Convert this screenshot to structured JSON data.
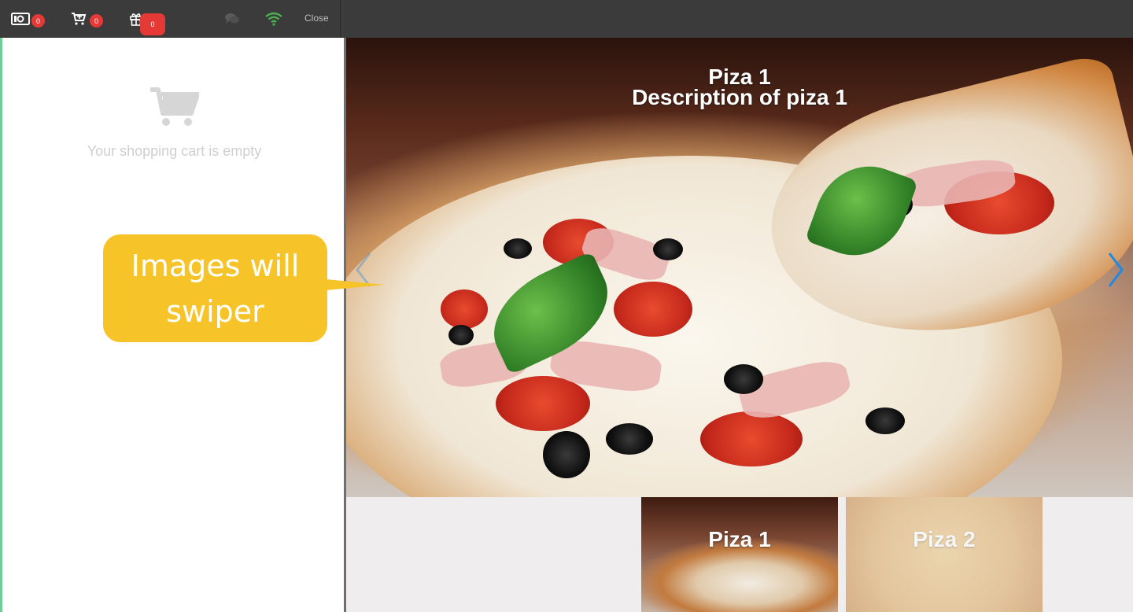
{
  "topbar": {
    "wallet_badge": "0",
    "cart_badge": "0",
    "gift_badge": "0",
    "close_label": "Close",
    "wifi_color": "#4caf50"
  },
  "cart": {
    "empty_text": "Your shopping cart is empty"
  },
  "callout": {
    "line1": "Images will",
    "line2": "swiper",
    "color": "#f6c429"
  },
  "slider": {
    "title": "Piza 1",
    "description": "Description of piza 1",
    "arrow_color": "#1e88e5"
  },
  "thumbnails": [
    {
      "label": "Piza 1"
    },
    {
      "label": "Piza 2"
    }
  ]
}
